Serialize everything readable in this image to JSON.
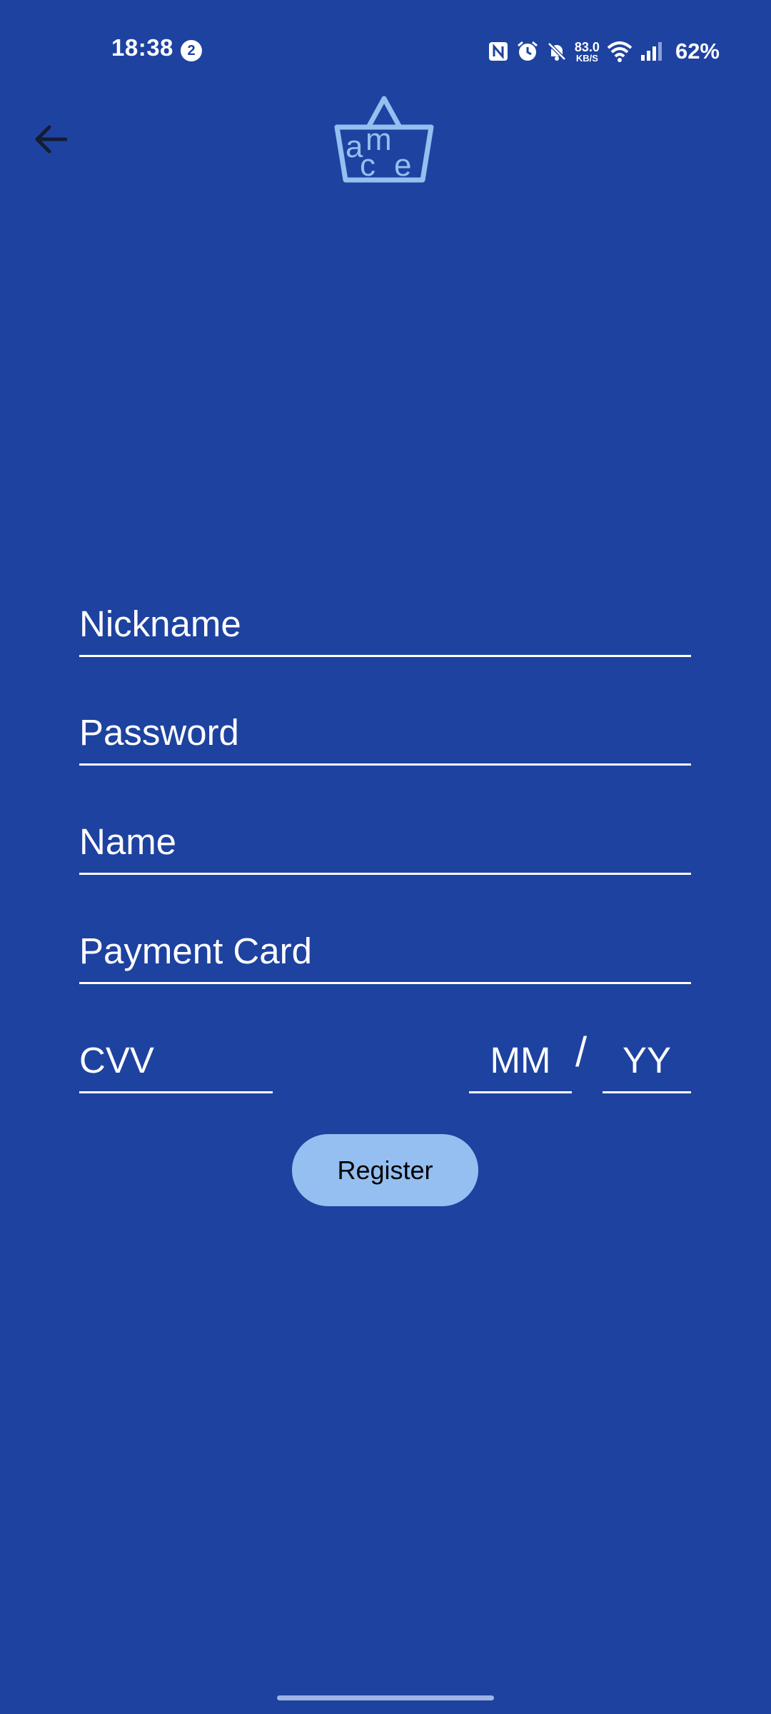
{
  "status_bar": {
    "time": "18:38",
    "notification_count": "2",
    "net_speed_value": "83.0",
    "net_speed_unit": "KB/S",
    "battery": "62%"
  },
  "header": {
    "back_icon": "arrow-left-icon",
    "logo_icon": "basket-logo-icon",
    "logo_letters": [
      "a",
      "m",
      "c",
      "e"
    ]
  },
  "form": {
    "nickname_placeholder": "Nickname",
    "password_placeholder": "Password",
    "name_placeholder": "Name",
    "payment_card_placeholder": "Payment Card",
    "cvv_placeholder": "CVV",
    "month_placeholder": "MM",
    "date_separator": "/",
    "year_placeholder": "YY",
    "register_label": "Register"
  },
  "colors": {
    "background": "#1e42a0",
    "accent": "#94bff0",
    "text": "#ffffff"
  }
}
